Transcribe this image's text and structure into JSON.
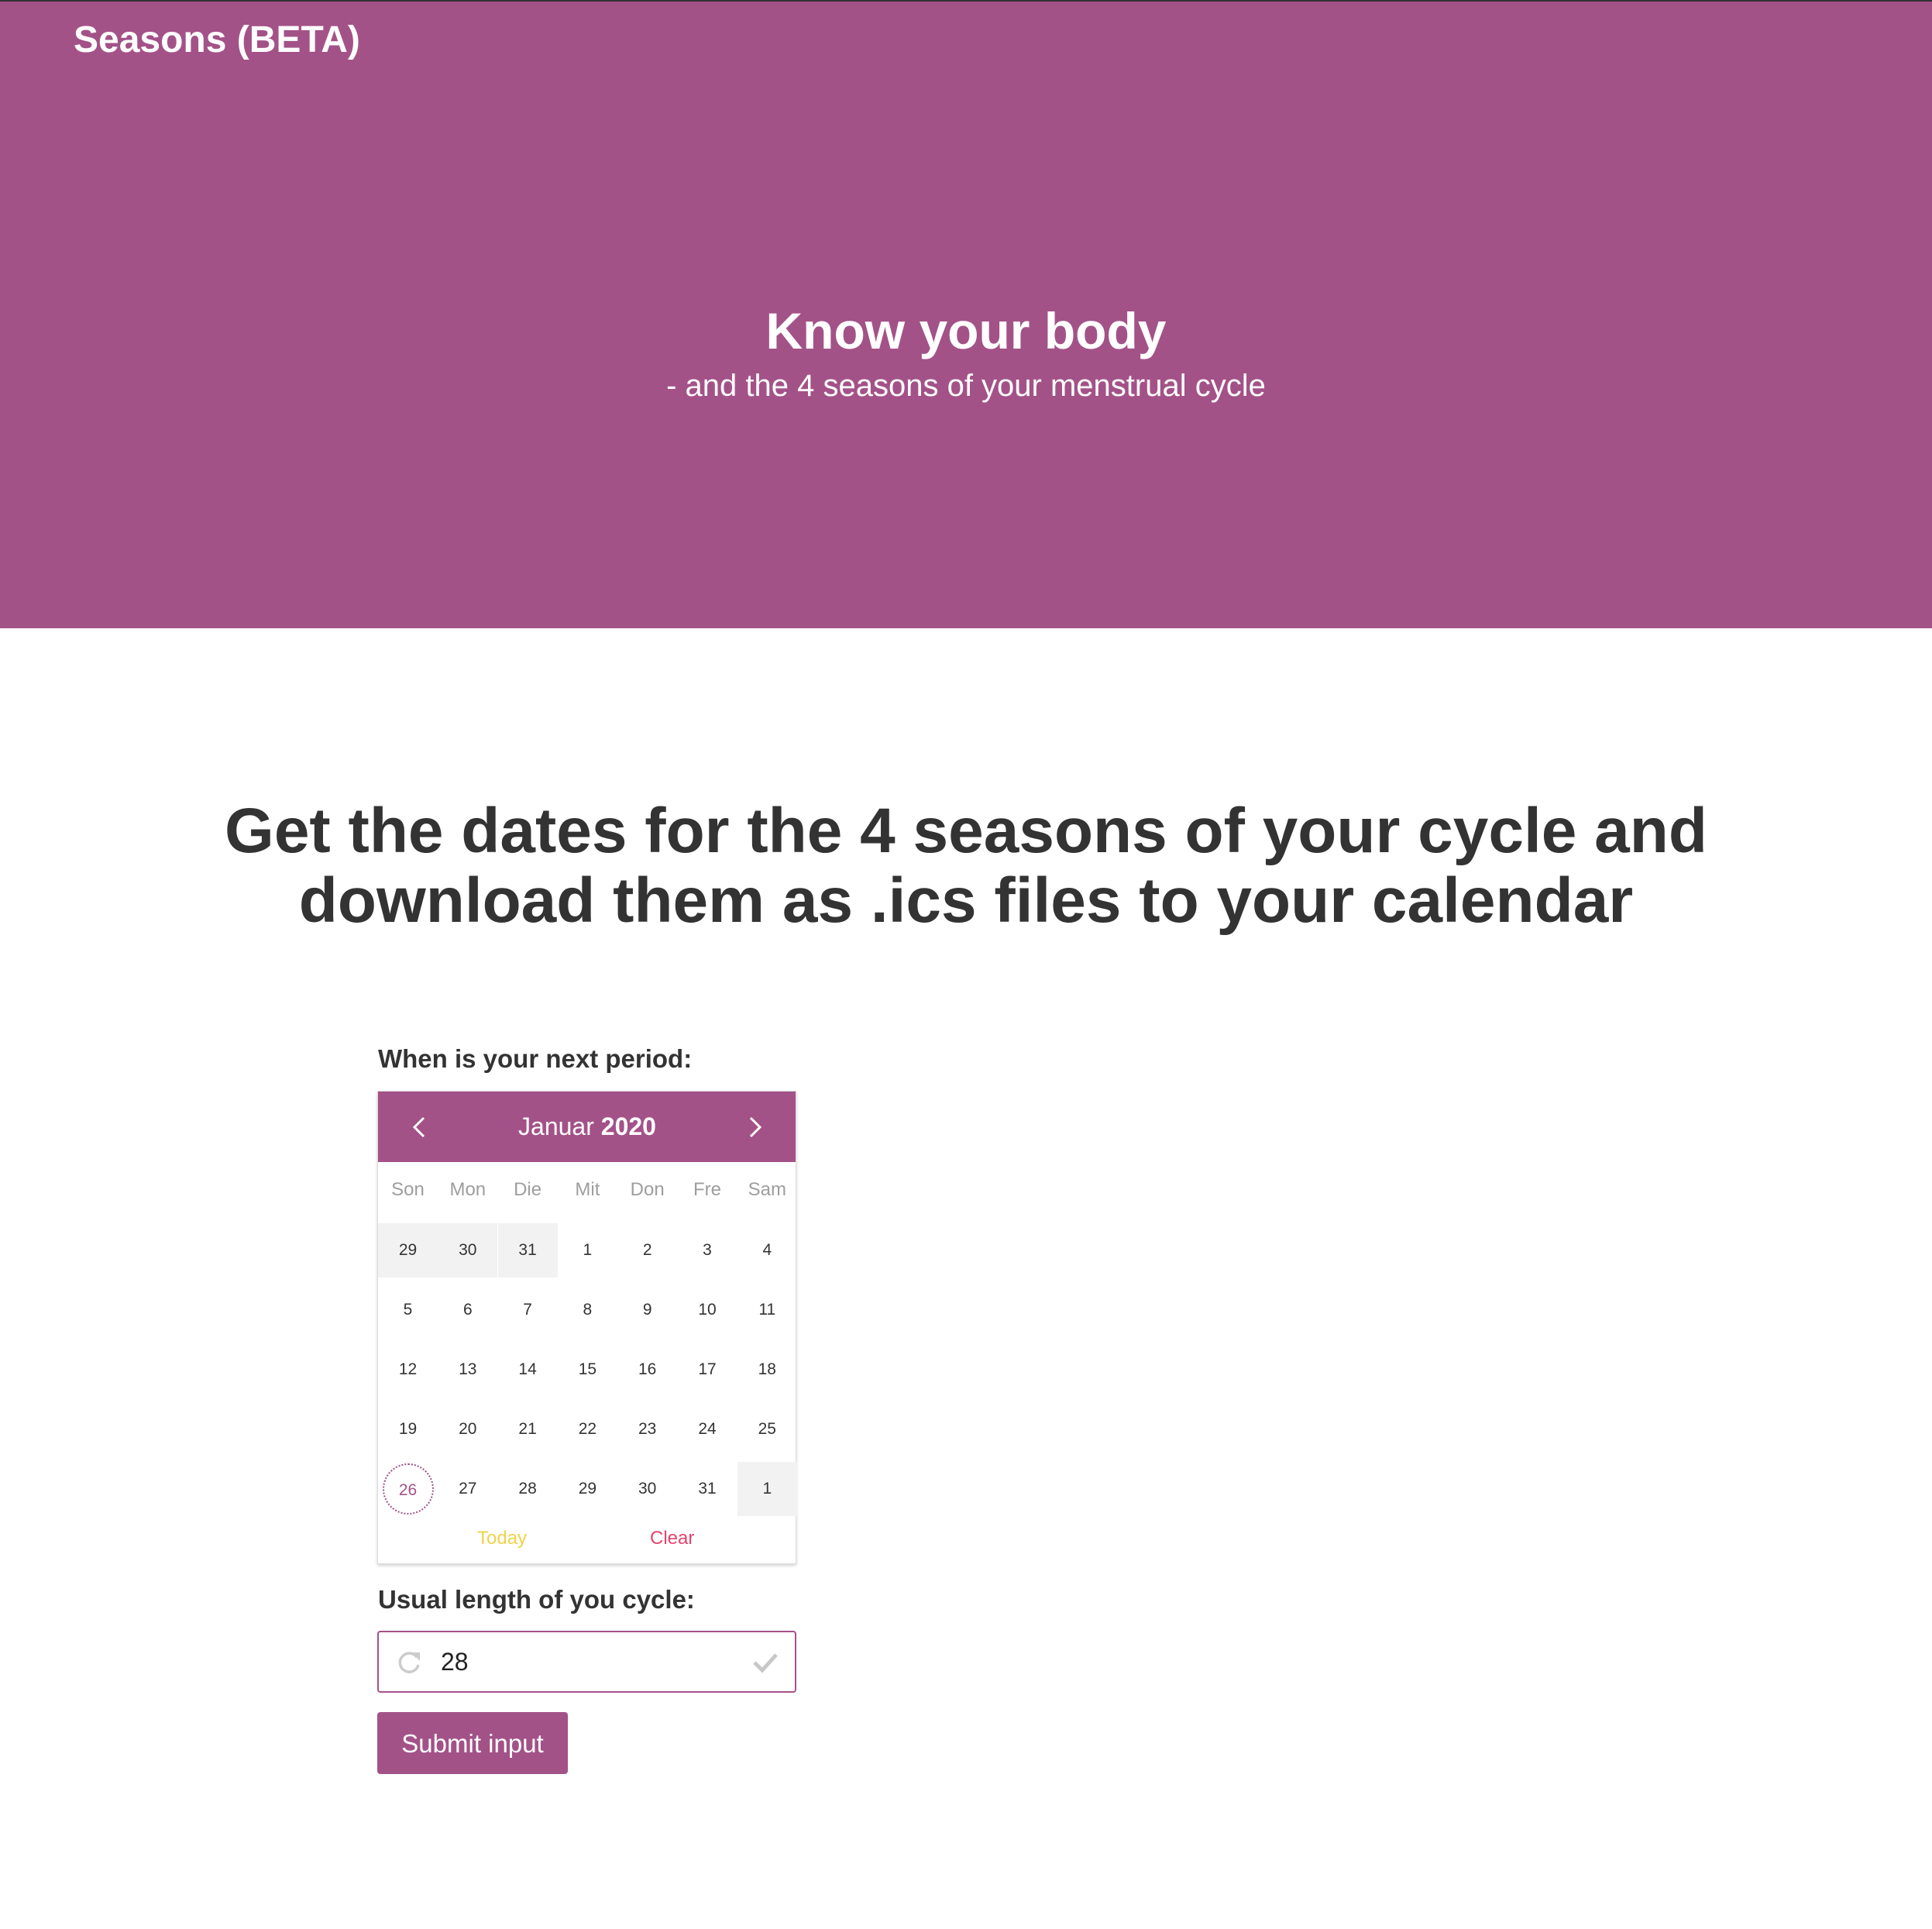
{
  "navbar": {
    "brand": "Seasons (BETA)"
  },
  "hero": {
    "title": "Know your body",
    "subtitle": "- and the 4 seasons of your menstrual cycle"
  },
  "main": {
    "heading_line1": "Get the dates for the 4 seasons of your cycle and",
    "heading_line2": "download them as .ics files to your calendar"
  },
  "form": {
    "period_label": "When is your next period:",
    "cycle_label": "Usual length of you cycle:",
    "cycle_value": "28",
    "submit_label": "Submit input"
  },
  "datepicker": {
    "month": "Januar",
    "year": "2020",
    "weekdays": [
      "Son",
      "Mon",
      "Die",
      "Mit",
      "Don",
      "Fre",
      "Sam"
    ],
    "weeks": [
      [
        "29",
        "30",
        "31",
        "1",
        "2",
        "3",
        "4"
      ],
      [
        "5",
        "6",
        "7",
        "8",
        "9",
        "10",
        "11"
      ],
      [
        "12",
        "13",
        "14",
        "15",
        "16",
        "17",
        "18"
      ],
      [
        "19",
        "20",
        "21",
        "22",
        "23",
        "24",
        "25"
      ],
      [
        "26",
        "27",
        "28",
        "29",
        "30",
        "31",
        "1"
      ]
    ],
    "highlighted_day": "26",
    "today_label": "Today",
    "clear_label": "Clear",
    "colors": {
      "accent": "#a35288",
      "today": "#f0d24a",
      "clear": "#e0456e"
    }
  },
  "icons": {
    "prev": "chevron-left-icon",
    "next": "chevron-right-icon",
    "input_left": "refresh-icon",
    "input_right": "checkmark-icon"
  }
}
